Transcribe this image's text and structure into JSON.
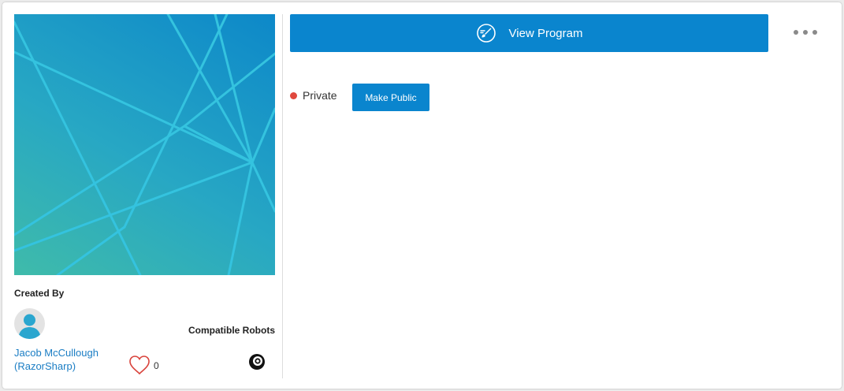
{
  "program": {
    "view_label": "View Program",
    "view_icon": "paintbrush-circle-icon",
    "more_icon": "ellipsis-icon"
  },
  "status": {
    "label": "Private",
    "dot_color": "#e0483e",
    "make_public_label": "Make Public"
  },
  "creator": {
    "section_label": "Created By",
    "name_line1": "Jacob McCullough",
    "name_line2": "(RazorSharp)",
    "avatar_icon": "user-avatar-icon"
  },
  "likes": {
    "icon": "heart-icon",
    "count": "0",
    "color": "#d9423b"
  },
  "robots": {
    "section_label": "Compatible Robots",
    "icon": "sphero-robot-icon"
  },
  "colors": {
    "accent": "#0a85ce",
    "link": "#1a7dc4"
  }
}
